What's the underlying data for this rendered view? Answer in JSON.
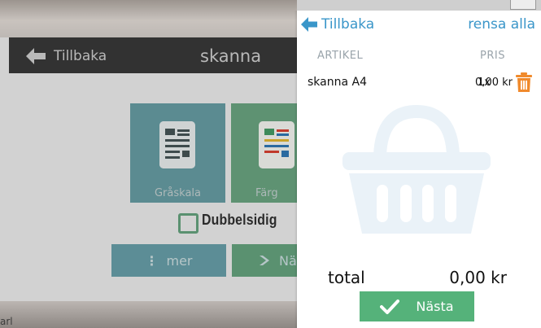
{
  "background_screen": {
    "back_label": "Tillbaka",
    "title": "skanna",
    "options": [
      {
        "label": "Gråskala"
      },
      {
        "label": "Färg"
      }
    ],
    "duplex_label": "Dubbelsidig",
    "more_label": "mer",
    "next_label": "Nä",
    "corner_text": "arl"
  },
  "cart": {
    "back_label": "Tillbaka",
    "clear_label": "rensa alla",
    "columns": {
      "article": "ARTIKEL",
      "price": "PRIS"
    },
    "items": [
      {
        "name": "skanna A4",
        "quantity": "1x",
        "price": "0,00 kr"
      }
    ],
    "total_label": "total",
    "total_value": "0,00 kr",
    "next_label": "Nästa"
  },
  "colors": {
    "accent_blue": "#3a96c9",
    "next_green": "#55b27a",
    "trash_orange": "#f08a2c",
    "basket_light_blue": "#eaf2f8"
  },
  "icons": {
    "back": "arrow-left-icon",
    "trash": "trash-icon",
    "basket": "basket-icon",
    "check": "checkmark-icon"
  }
}
